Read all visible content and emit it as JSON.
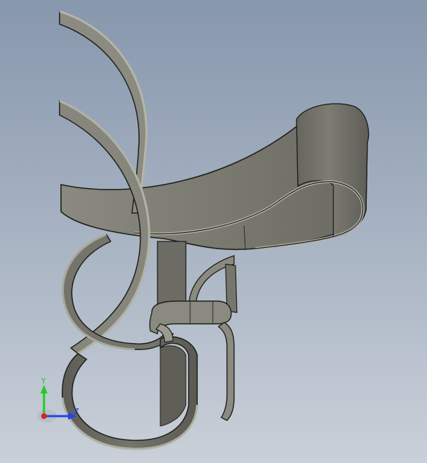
{
  "viewport": {
    "background_top": "#8797ad",
    "background_bottom": "#c9d0d9"
  },
  "model": {
    "surface_color": "#7d7d74",
    "edge_color": "#1f1f1c",
    "rim_color": "#a9a99d"
  },
  "triad": {
    "y_label": "Y",
    "z_label": "Z",
    "y_color": "#22cc22",
    "z_color": "#2244ee",
    "origin_color": "#dd2222"
  }
}
